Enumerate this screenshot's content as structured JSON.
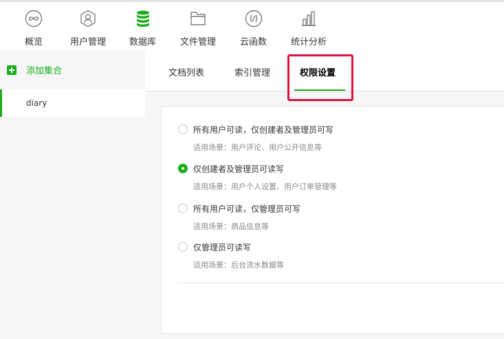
{
  "nav": {
    "items": [
      {
        "label": "概览",
        "icon": "infinity-icon"
      },
      {
        "label": "用户管理",
        "icon": "users-icon"
      },
      {
        "label": "数据库",
        "icon": "database-icon"
      },
      {
        "label": "文件管理",
        "icon": "folder-icon"
      },
      {
        "label": "云函数",
        "icon": "function-icon"
      },
      {
        "label": "统计分析",
        "icon": "bar-chart-icon"
      }
    ],
    "active": "数据库"
  },
  "sidebar": {
    "add_label": "添加集合",
    "collections": [
      "diary"
    ]
  },
  "tabs": {
    "items": [
      "文档列表",
      "索引管理",
      "权限设置"
    ],
    "active": "权限设置"
  },
  "permissions": {
    "selected_index": 1,
    "options": [
      {
        "title": "所有用户可读，仅创建者及管理员可写",
        "desc": "适用场景：用户评论、用户公开信息等"
      },
      {
        "title": "仅创建者及管理员可读写",
        "desc": "适用场景：用户个人设置、用户订单管理等"
      },
      {
        "title": "所有用户可读，仅管理员可写",
        "desc": "适用场景：商品信息等"
      },
      {
        "title": "仅管理员可读写",
        "desc": "适用场景：后台流水数据等"
      }
    ]
  },
  "colors": {
    "accent": "#1aad19",
    "highlight": "#e0103a",
    "icon_gray": "#7d7d7d"
  }
}
